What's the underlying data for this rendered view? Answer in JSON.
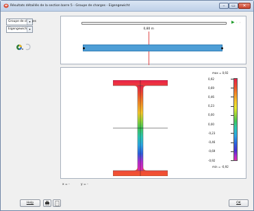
{
  "window": {
    "title": "Résultats détaillés de la section barre 5 - Groupe de charges - Eigengewicht",
    "min_glyph": "–",
    "max_glyph": "▭",
    "close_glyph": "✕"
  },
  "left": {
    "group_select": {
      "value": "Groupe de charges",
      "arrow": "▾"
    },
    "case_select": {
      "value": "Eigengewicht",
      "arrow": "▾"
    },
    "view_tool_icon": "colorwheel-icon"
  },
  "member": {
    "position_label": "0,80 m",
    "play_glyph": "▶",
    "step_glyphs": "› ›",
    "slider_position": 0.46,
    "beam_color": "#4e9ed6",
    "section_line_color": "#e04a4a"
  },
  "legend": {
    "max_label": "max = 0,92",
    "min_label": "min = -0,92",
    "ticks": [
      "0,92",
      "0,69",
      "0,46",
      "0,23",
      "0,00",
      "0,00",
      "-0,23",
      "-0,46",
      "-0,69",
      "-0,92"
    ]
  },
  "status": {
    "x_readout": "x = -",
    "y_readout": "y = -"
  },
  "buttons": {
    "help": "Help",
    "ok": "OK"
  },
  "colors": {
    "accent": "#4e9ed6",
    "close": "#c6412b",
    "play": "#1e9c2a"
  }
}
